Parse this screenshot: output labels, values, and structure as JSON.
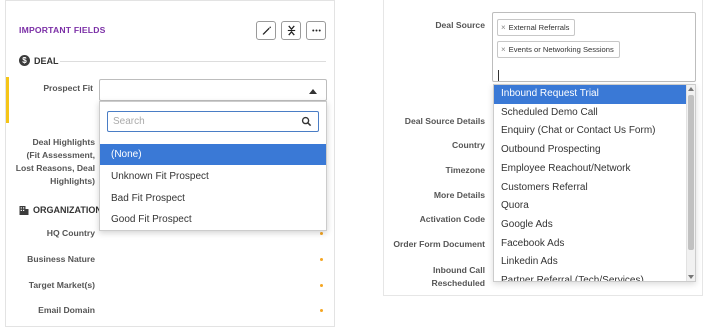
{
  "left": {
    "header": {
      "title": "IMPORTANT FIELDS"
    },
    "deal_section": {
      "title": "DEAL"
    },
    "prospect_fit": {
      "label": "Prospect Fit",
      "search_placeholder": "Search",
      "options": [
        "(None)",
        "Unknown Fit Prospect",
        "Bad Fit Prospect",
        "Good Fit Prospect"
      ],
      "selected_index": 0
    },
    "deal_highlights_label": [
      "Deal Highlights",
      "(Fit Assessment,",
      "Lost Reasons, Deal",
      "Highlights)"
    ],
    "org_section": {
      "title": "ORGANIZATION"
    },
    "org_fields": [
      "HQ Country",
      "Business Nature",
      "Target Market(s)",
      "Email Domain"
    ]
  },
  "right": {
    "deal_source": {
      "label": "Deal Source",
      "tags": [
        "External Referrals",
        "Events or Networking Sessions"
      ],
      "options": [
        "Inbound Request Trial",
        "Scheduled Demo Call",
        "Enquiry (Chat or Contact Us Form)",
        "Outbound Prospecting",
        "Employee Reachout/Network",
        "Customers Referral",
        "Quora",
        "Google Ads",
        "Facebook Ads",
        "Linkedin Ads",
        "Partner Referral (Tech/Services)"
      ],
      "selected_index": 0
    },
    "field_labels": [
      "Deal Source Details",
      "Country",
      "Timezone",
      "More Details",
      "Activation Code",
      "Order Form Document"
    ],
    "inbound_call_label": [
      "Inbound Call",
      "Rescheduled"
    ]
  },
  "colors": {
    "accent_purple": "#7b2fa6",
    "highlight_blue": "#3a79d6",
    "required_dot": "#f5a623",
    "yellow_bar": "#f5c518"
  }
}
